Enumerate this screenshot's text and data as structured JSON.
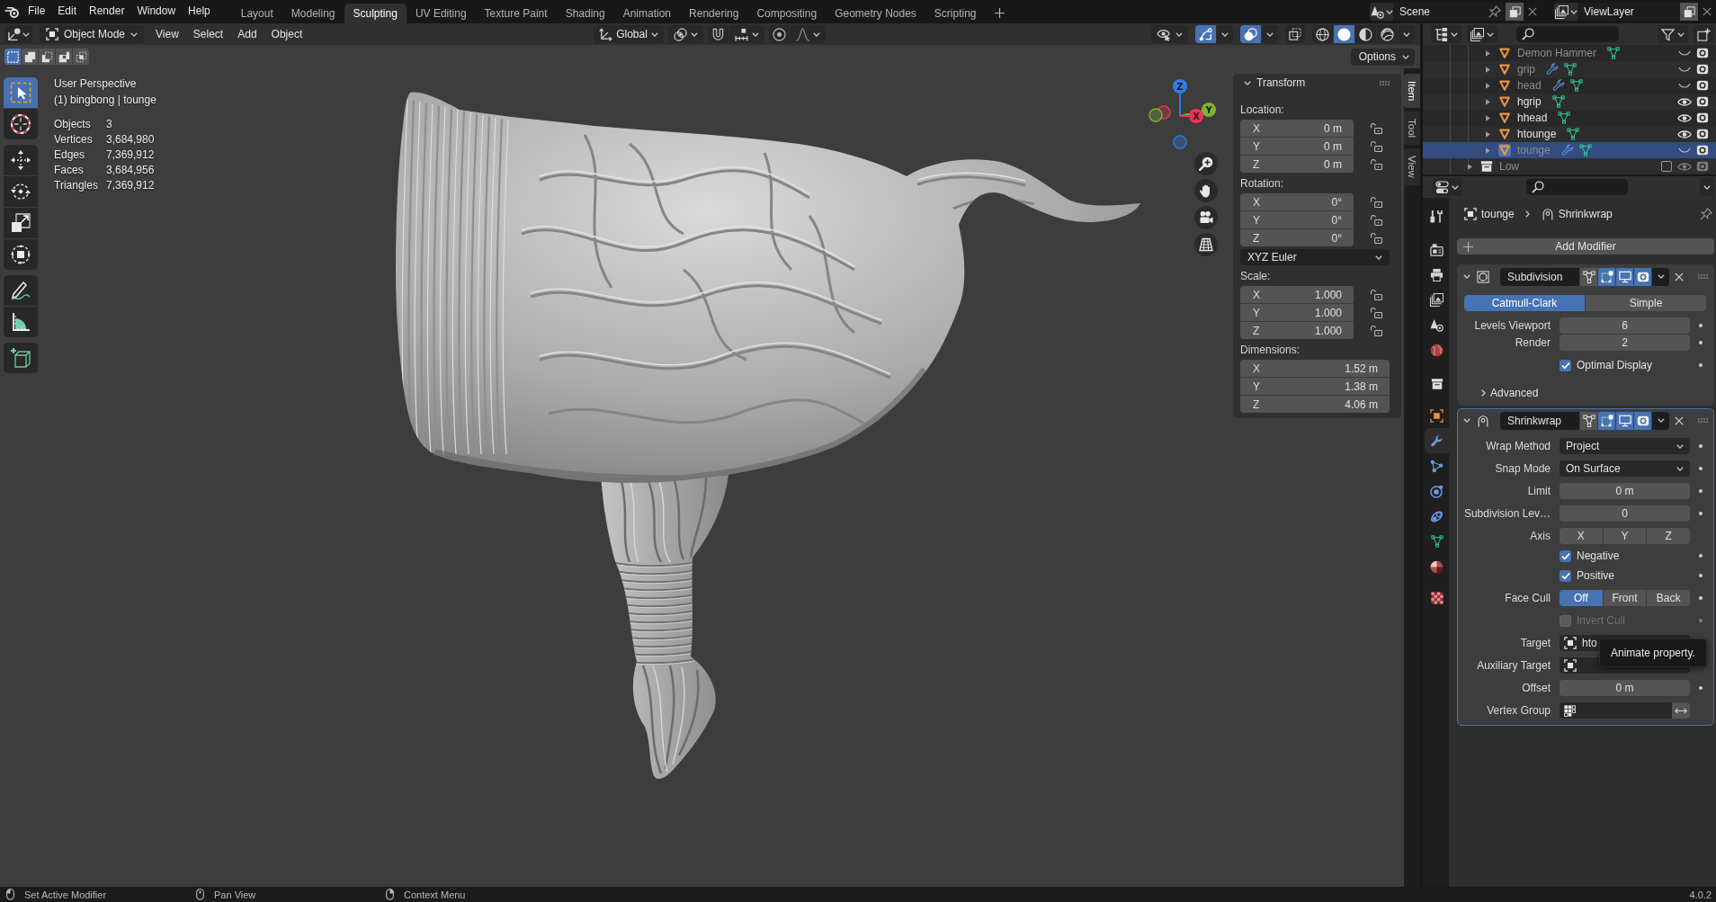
{
  "top_bar": {
    "menus": [
      "File",
      "Edit",
      "Render",
      "Window",
      "Help"
    ],
    "workspaces": [
      {
        "label": "Layout",
        "selected": false
      },
      {
        "label": "Modeling",
        "selected": false
      },
      {
        "label": "Sculpting",
        "selected": true
      },
      {
        "label": "UV Editing",
        "selected": false
      },
      {
        "label": "Texture Paint",
        "selected": false
      },
      {
        "label": "Shading",
        "selected": false
      },
      {
        "label": "Animation",
        "selected": false
      },
      {
        "label": "Rendering",
        "selected": false
      },
      {
        "label": "Compositing",
        "selected": false
      },
      {
        "label": "Geometry Nodes",
        "selected": false
      },
      {
        "label": "Scripting",
        "selected": false
      }
    ],
    "scene": "Scene",
    "view_layer": "ViewLayer"
  },
  "viewport_header": {
    "mode": "Object Mode",
    "menus": [
      "View",
      "Select",
      "Add",
      "Object"
    ],
    "orientation": "Global",
    "toggles": [
      {
        "kind": "gizmos",
        "on": true
      },
      {
        "kind": "overlays",
        "on": true
      },
      {
        "kind": "xray",
        "on": false
      }
    ],
    "shading": [
      {
        "kind": "wireframe",
        "selected": false
      },
      {
        "kind": "solid",
        "selected": true
      },
      {
        "kind": "material",
        "selected": false
      },
      {
        "kind": "rendered",
        "selected": false
      }
    ]
  },
  "tool_header": {
    "select_modes": [
      {
        "kind": "set",
        "selected": true
      },
      {
        "kind": "extend",
        "selected": false
      },
      {
        "kind": "subtract",
        "selected": false
      },
      {
        "kind": "invert",
        "selected": false
      },
      {
        "kind": "intersect",
        "selected": false
      }
    ],
    "options": "Options"
  },
  "toolbar": [
    {
      "kind": "select_box",
      "selected": true
    },
    {
      "kind": "cursor",
      "selected": false
    },
    {
      "kind": "move",
      "selected": false
    },
    {
      "kind": "rotate",
      "selected": false
    },
    {
      "kind": "scale",
      "selected": false
    },
    {
      "kind": "transform",
      "selected": false
    },
    {
      "kind": "annotate",
      "selected": false
    },
    {
      "kind": "measure",
      "selected": false
    },
    {
      "kind": "add_cube",
      "selected": false
    }
  ],
  "viewport": {
    "view_name": "User Perspective",
    "object_info": "(1) bingbong | tounge",
    "stats": [
      {
        "label": "Objects",
        "value": "3"
      },
      {
        "label": "Vertices",
        "value": "3,684,980"
      },
      {
        "label": "Edges",
        "value": "7,369,912"
      },
      {
        "label": "Faces",
        "value": "3,684,956"
      },
      {
        "label": "Triangles",
        "value": "7,369,912"
      }
    ],
    "gizmo_axes": [
      {
        "label": "Z",
        "color": "#2c7fe8"
      },
      {
        "label": "Y",
        "color": "#7cb82f"
      },
      {
        "label": "X",
        "color": "#f0334f"
      }
    ]
  },
  "sidebar": {
    "tabs": [
      {
        "label": "Item",
        "selected": true
      },
      {
        "label": "Tool",
        "selected": false
      },
      {
        "label": "View",
        "selected": false
      }
    ],
    "panel": {
      "title": "Transform",
      "expanded": true,
      "sections": [
        {
          "kind": "vector",
          "label": "Location:",
          "fields": [
            {
              "axis": "X",
              "value": "0 m",
              "locked": false
            },
            {
              "axis": "Y",
              "value": "0 m",
              "locked": false
            },
            {
              "axis": "Z",
              "value": "0 m",
              "locked": false
            }
          ]
        },
        {
          "kind": "vector",
          "label": "Rotation:",
          "fields": [
            {
              "axis": "X",
              "value": "0°",
              "locked": false
            },
            {
              "axis": "Y",
              "value": "0°",
              "locked": false
            },
            {
              "axis": "Z",
              "value": "0°",
              "locked": false
            }
          ]
        },
        {
          "kind": "dropdown",
          "value": "XYZ Euler"
        },
        {
          "kind": "vector",
          "label": "Scale:",
          "fields": [
            {
              "axis": "X",
              "value": "1.000",
              "locked": false
            },
            {
              "axis": "Y",
              "value": "1.000",
              "locked": false
            },
            {
              "axis": "Z",
              "value": "1.000",
              "locked": false
            }
          ]
        },
        {
          "kind": "vector",
          "label": "Dimensions:",
          "fields": [
            {
              "axis": "X",
              "value": "1.52 m"
            },
            {
              "axis": "Y",
              "value": "1.38 m"
            },
            {
              "axis": "Z",
              "value": "4.06 m"
            }
          ]
        }
      ]
    }
  },
  "outliner": {
    "items": [
      {
        "children": [
          {
            "kind": "object",
            "name": "Demon Hammer",
            "modifiers": false,
            "visible": false,
            "selected": false
          },
          {
            "kind": "object",
            "name": "grip",
            "modifiers": true,
            "visible": false,
            "selected": false
          },
          {
            "kind": "object",
            "name": "head",
            "modifiers": true,
            "visible": false,
            "selected": false
          },
          {
            "kind": "object",
            "name": "hgrip",
            "modifiers": false,
            "visible": true,
            "selected": false
          },
          {
            "kind": "object",
            "name": "hhead",
            "modifiers": false,
            "visible": true,
            "selected": false
          },
          {
            "kind": "object",
            "name": "htounge",
            "modifiers": false,
            "visible": true,
            "selected": false
          },
          {
            "kind": "object",
            "name": "tounge",
            "modifiers": true,
            "visible": false,
            "selected": true
          }
        ]
      },
      {
        "kind": "collection",
        "name": "Low",
        "enabled": false,
        "visible": true,
        "selected": false
      }
    ]
  },
  "properties": {
    "tabs": [
      {
        "kind": "tool",
        "selected": false
      },
      {
        "kind": "render",
        "selected": false
      },
      {
        "kind": "output",
        "selected": false
      },
      {
        "kind": "view_layer",
        "selected": false
      },
      {
        "kind": "scene",
        "selected": false
      },
      {
        "kind": "world",
        "selected": false
      },
      {
        "kind": "collection",
        "selected": false
      },
      {
        "kind": "object",
        "selected": false
      },
      {
        "kind": "modifiers",
        "selected": true
      },
      {
        "kind": "particles",
        "selected": false
      },
      {
        "kind": "physics",
        "selected": false
      },
      {
        "kind": "constraints",
        "selected": false
      },
      {
        "kind": "data",
        "selected": false
      },
      {
        "kind": "material",
        "selected": false
      },
      {
        "kind": "texture",
        "selected": false
      }
    ],
    "breadcrumb": [
      "tounge",
      "Shrinkwrap"
    ],
    "add_modifier": "Add Modifier",
    "modifiers": [
      {
        "kind": "subdivision",
        "name": "Subdivision",
        "active": false,
        "expanded": true,
        "on_cage": false,
        "edit_mode": true,
        "viewport": true,
        "render": true,
        "rows": [
          {
            "kind": "segmented",
            "options": [
              {
                "label": "Catmull-Clark",
                "selected": true
              },
              {
                "label": "Simple",
                "selected": false
              }
            ]
          },
          {
            "kind": "number",
            "label": "Levels Viewport",
            "value": "6"
          },
          {
            "kind": "number",
            "label": "Render",
            "value": "2"
          },
          {
            "kind": "checkbox",
            "label": "Optimal Display",
            "checked": true,
            "disabled": false
          },
          {
            "kind": "subpanel",
            "label": "Advanced",
            "expanded": false
          }
        ]
      },
      {
        "kind": "shrinkwrap",
        "name": "Shrinkwrap",
        "active": true,
        "expanded": true,
        "on_cage": false,
        "edit_mode": true,
        "viewport": true,
        "render": true,
        "rows": [
          {
            "kind": "dropdown",
            "label": "Wrap Method",
            "value": "Project"
          },
          {
            "kind": "dropdown",
            "label": "Snap Mode",
            "value": "On Surface"
          },
          {
            "kind": "number",
            "label": "Limit",
            "value": "0 m"
          },
          {
            "kind": "number",
            "label": "Subdivision Lev…",
            "value": "0"
          },
          {
            "kind": "toggles",
            "label": "Axis",
            "options": [
              {
                "label": "X",
                "selected": false
              },
              {
                "label": "Y",
                "selected": false
              },
              {
                "label": "Z",
                "selected": false
              }
            ]
          },
          {
            "kind": "checkbox",
            "label": "Negative",
            "checked": true,
            "disabled": false
          },
          {
            "kind": "checkbox",
            "label": "Positive",
            "checked": true,
            "disabled": false
          },
          {
            "kind": "segmented",
            "label": "Face Cull",
            "options": [
              {
                "label": "Off",
                "selected": true
              },
              {
                "label": "Front",
                "selected": false
              },
              {
                "label": "Back",
                "selected": false
              }
            ]
          },
          {
            "kind": "checkbox",
            "label": "Invert Cull",
            "checked": false,
            "disabled": true
          },
          {
            "kind": "object",
            "label": "Target",
            "value": "hto"
          },
          {
            "kind": "object",
            "label": "Auxiliary Target"
          },
          {
            "kind": "number",
            "label": "Offset",
            "value": "0 m"
          },
          {
            "kind": "vertex_group",
            "label": "Vertex Group"
          }
        ]
      }
    ]
  },
  "tooltip": "Animate property.",
  "status_bar": {
    "hints": [
      {
        "kind": "left_mouse",
        "label": "Set Active Modifier"
      },
      {
        "kind": "middle_mouse",
        "label": "Pan View"
      },
      {
        "kind": "right_mouse",
        "label": "Context Menu"
      }
    ],
    "version": "4.0.2"
  }
}
